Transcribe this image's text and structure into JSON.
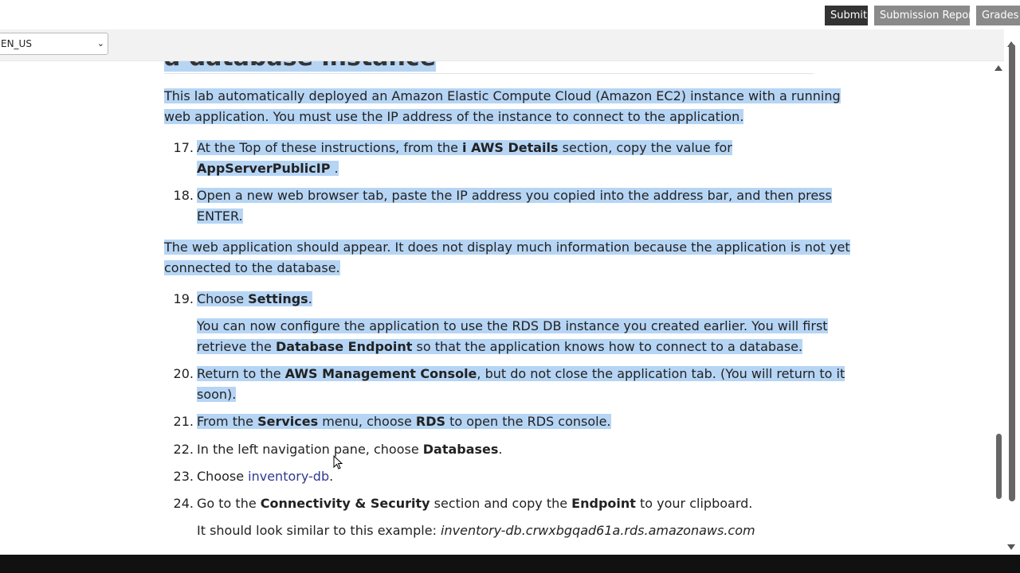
{
  "toolbar": {
    "submit": "Submit",
    "submission_report": "Submission Report",
    "grades": "Grades"
  },
  "language": {
    "selected": "EN_US"
  },
  "heading": "a database instance",
  "intro": "This lab automatically deployed an Amazon Elastic Compute Cloud (Amazon EC2) instance with a running",
  "intro2": "web application. You must use the IP address of the instance to connect to the application.",
  "steps": {
    "s17": {
      "num": "17.",
      "t1": "At the Top of these instructions, from the ",
      "b1": "i AWS Details",
      "t2": " section, copy the value for",
      "b2": "AppServerPublicIP",
      "t3": " ."
    },
    "s18": {
      "num": "18.",
      "t1": "Open a new web browser tab, paste the IP address you copied into the address bar, and then press",
      "t2": "ENTER."
    },
    "s19": {
      "num": "19.",
      "t1": "Choose ",
      "b1": "Settings",
      "t2": ".",
      "sub1": "You can now configure the application to use the RDS DB instance you created earlier. You will first",
      "sub2a": "retrieve the ",
      "sub2b": "Database Endpoint",
      "sub2c": " so that the application knows how to connect to a database."
    },
    "s20": {
      "num": "20.",
      "t1": "Return to the ",
      "b1": "AWS Management Console",
      "t2": ", but do not close the application tab. (You will return to it",
      "t3": "soon)."
    },
    "s21": {
      "num": "21.",
      "t1": "From the  ",
      "b1": "Services",
      "t2": " menu, choose ",
      "b2": "RDS",
      "t3": " to open the RDS console."
    },
    "s22": {
      "num": "22.",
      "t1": "In the left navigation pane, choose ",
      "b1": "Databases",
      "t2": "."
    },
    "s23": {
      "num": "23.",
      "t1": "Choose ",
      "link": "inventory-db",
      "t2": "."
    },
    "s24": {
      "num": "24.",
      "t1": "Go to the ",
      "b1": "Connectivity & Security",
      "t2": " section and copy the ",
      "b2": "Endpoint",
      "t3": " to your clipboard.",
      "sub1": "It should look similar to this example: ",
      "sub2": "inventory-db.crwxbgqad61a.rds.amazonaws.com"
    }
  },
  "middle_para1": "The web application should appear. It does not display much information because the application is not yet",
  "middle_para2": "connected to the database."
}
